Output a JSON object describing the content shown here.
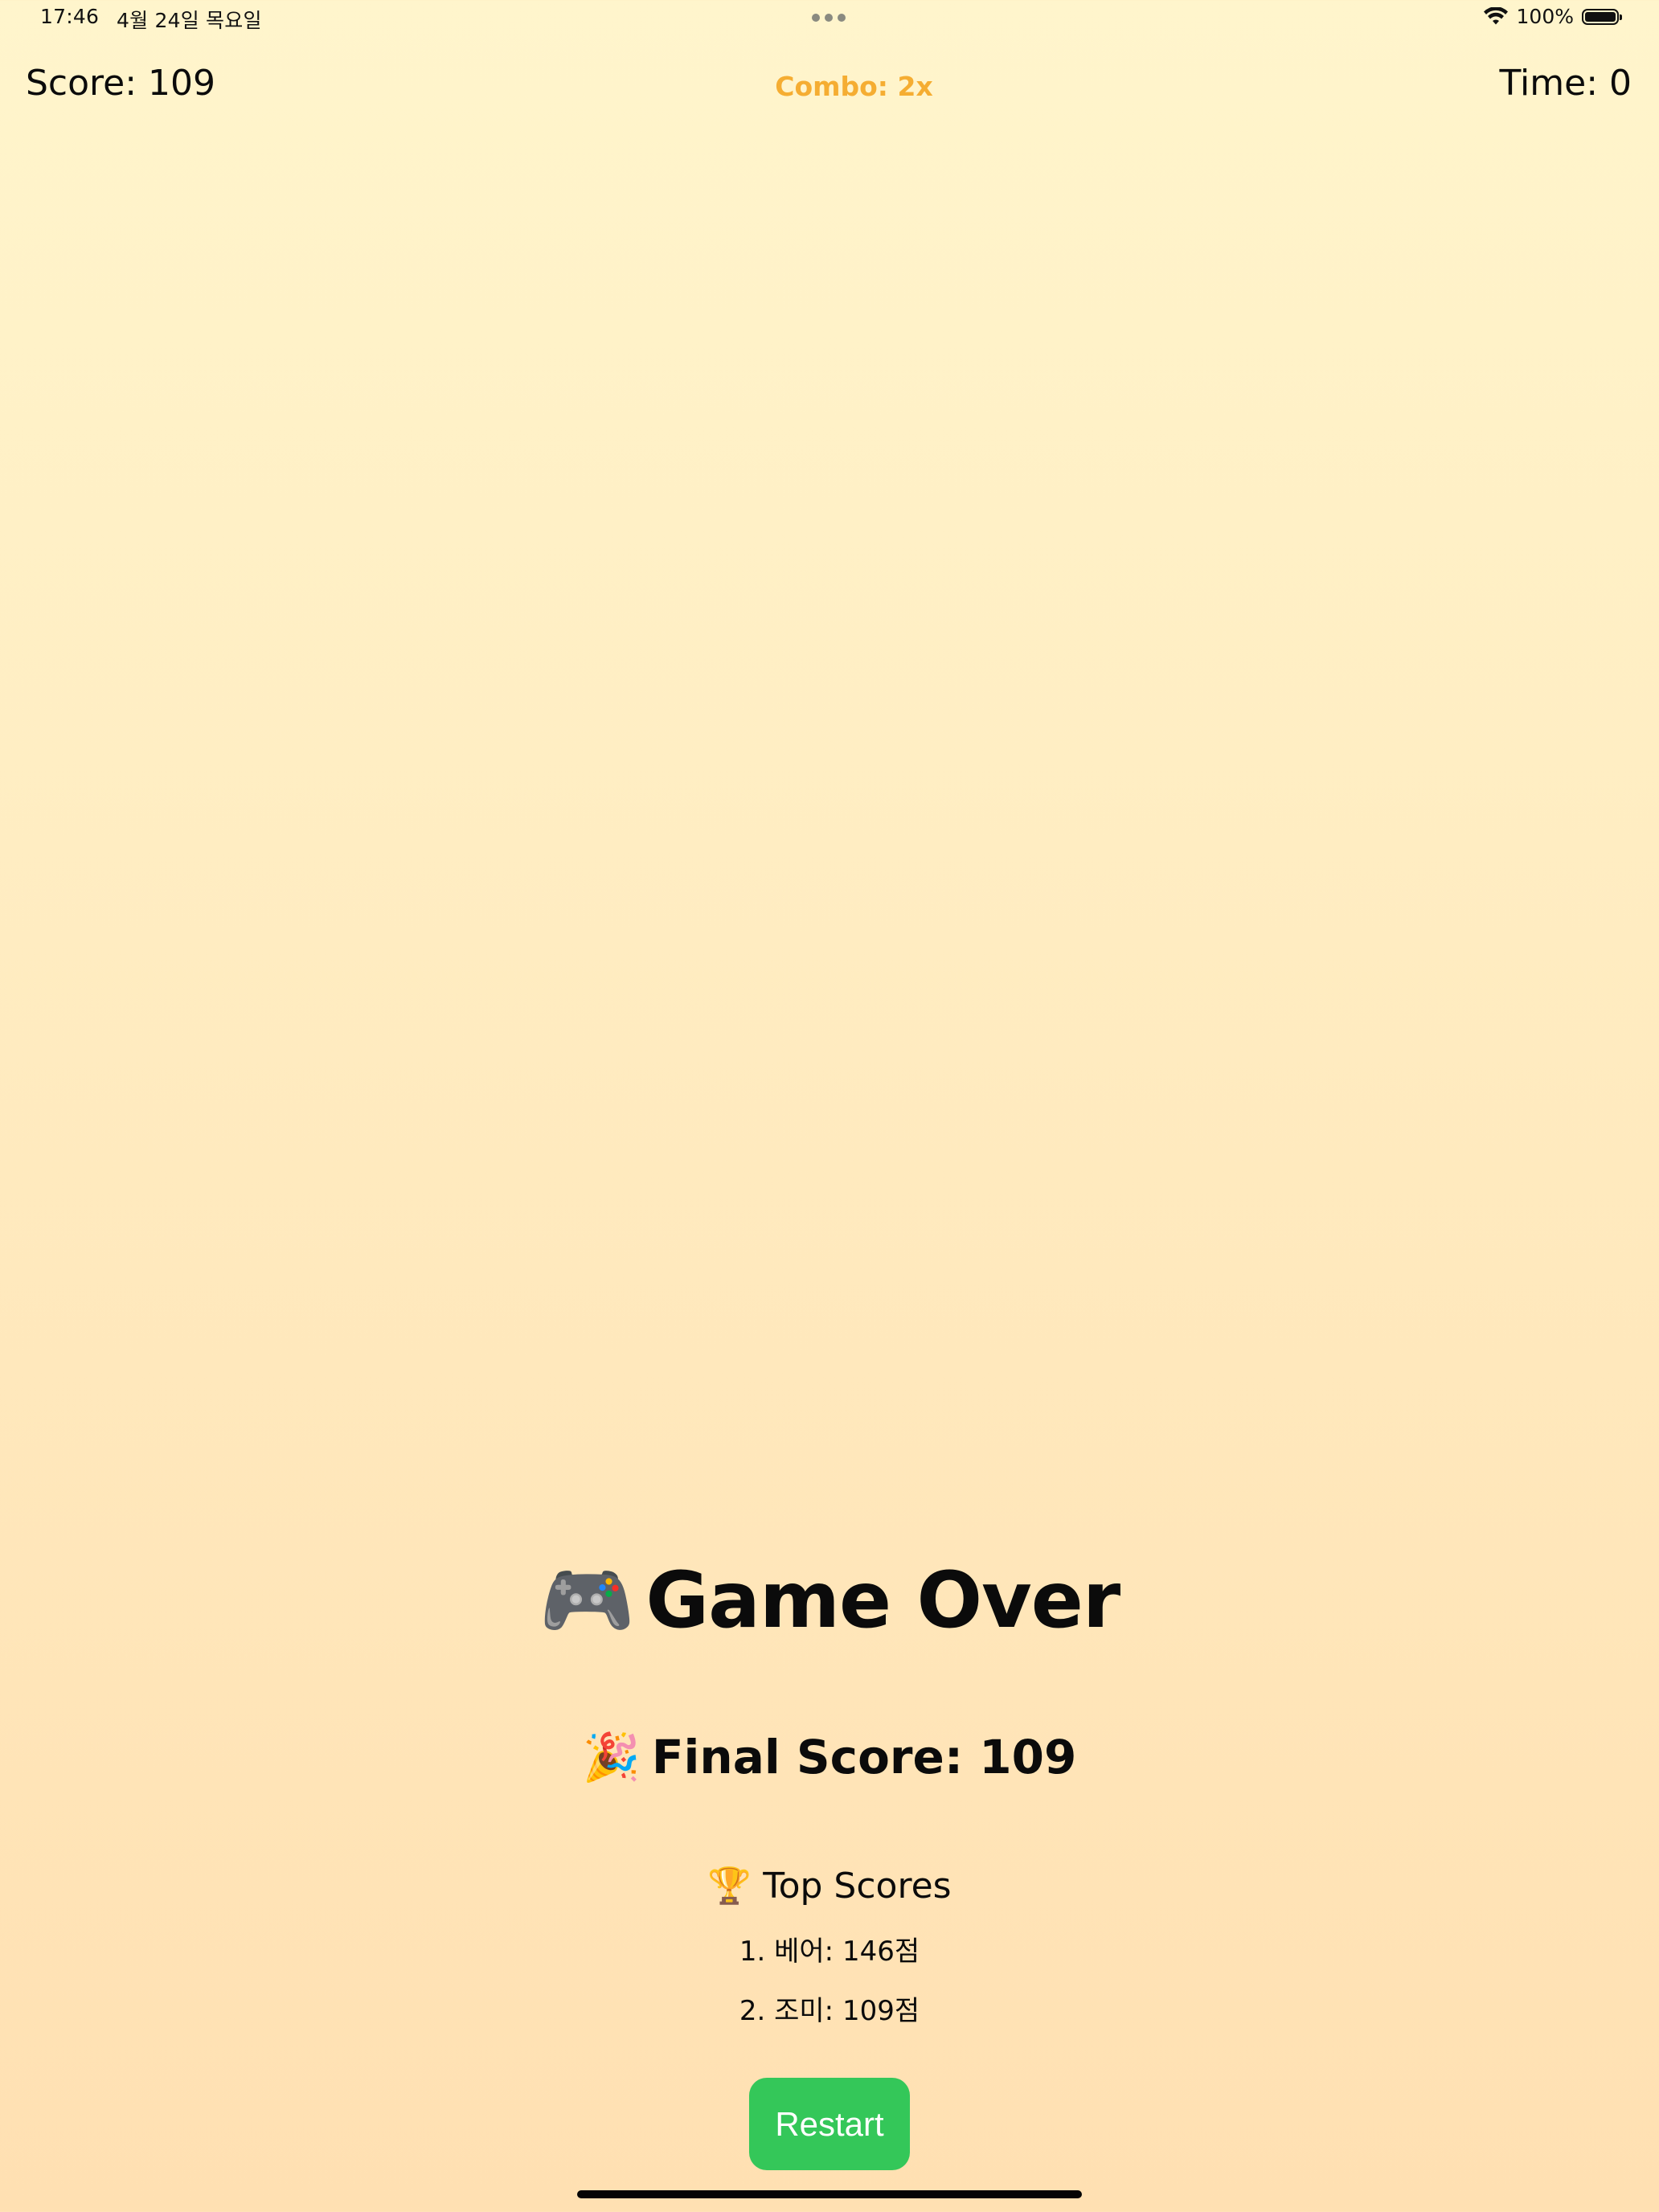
{
  "status_bar": {
    "time": "17:46",
    "date": "4월 24일 목요일",
    "battery": "100%",
    "battery_level": 1.0,
    "icons": [
      "wifi-icon",
      "battery-icon",
      "multitasking-dots-icon"
    ]
  },
  "hud": {
    "score": "Score: 109",
    "combo": "Combo: 2x",
    "time": "Time: 0"
  },
  "game_over": {
    "title": "Game Over",
    "title_emoji": "🎮",
    "final_score": "Final Score: 109",
    "final_score_emoji": "🎉"
  },
  "top_scores": {
    "title": "Top Scores",
    "title_emoji": "🏆",
    "entries": [
      "1. 베어: 146점",
      "2. 조미: 109점"
    ]
  },
  "buttons": {
    "restart": "Restart"
  },
  "colors": {
    "combo": "#f5ad32",
    "restart_button": "#34c759",
    "background_top": "#fff5cc",
    "background_bottom": "#ffe0b2"
  }
}
